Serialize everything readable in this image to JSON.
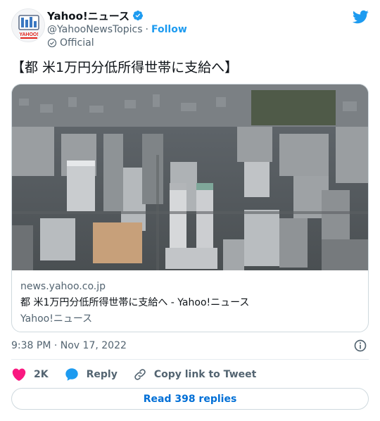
{
  "author": {
    "name": "Yahoo!ニュース",
    "handle": "@YahooNewsTopics",
    "follow_label": "Follow",
    "badge_label": "Official",
    "avatar_text": "YAHOO!"
  },
  "tweet": {
    "text": "【都 米1万円分低所得世帯に支給へ】",
    "timestamp": "9:38 PM · Nov 17, 2022"
  },
  "link_card": {
    "domain": "news.yahoo.co.jp",
    "title": "都 米1万円分低所得世帯に支給へ - Yahoo!ニュース",
    "site": "Yahoo!ニュース"
  },
  "actions": {
    "likes_count": "2K",
    "reply_label": "Reply",
    "copy_label": "Copy link to Tweet"
  },
  "read_replies_label": "Read 398 replies",
  "colors": {
    "accent": "#1d9bf0",
    "like": "#f91880",
    "muted": "#536471",
    "text": "#0f1419"
  },
  "icons": [
    "verified-icon",
    "official-check-icon",
    "twitter-bird-icon",
    "info-icon",
    "heart-icon",
    "reply-bubble-icon",
    "link-icon"
  ]
}
